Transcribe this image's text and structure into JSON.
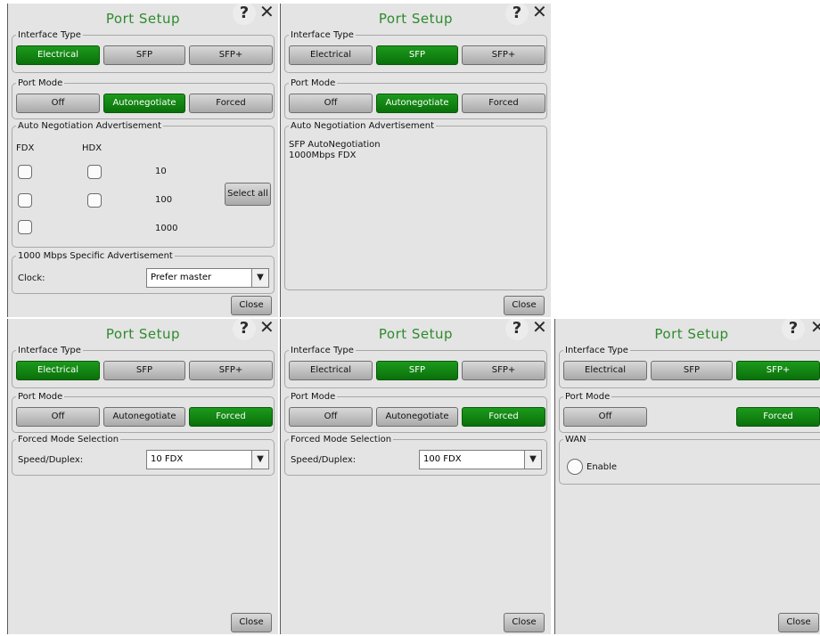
{
  "common": {
    "title": "Port Setup",
    "help_glyph": "?",
    "close_glyph": "✕",
    "interface_type_legend": "Interface Type",
    "port_mode_legend": "Port Mode",
    "iface": {
      "electrical": "Electrical",
      "sfp": "SFP",
      "sfp_plus": "SFP+"
    },
    "mode": {
      "off": "Off",
      "autonegotiate": "Autonegotiate",
      "forced": "Forced"
    },
    "close_label": "Close",
    "dropdown_arrow": "▼"
  },
  "panel1": {
    "selected_interface": "Electrical",
    "selected_mode": "Autonegotiate",
    "auto_neg_legend": "Auto Negotiation Advertisement",
    "fdx_header": "FDX",
    "hdx_header": "HDX",
    "speeds": [
      "10",
      "100",
      "1000"
    ],
    "select_all_label": "Select all",
    "specific_legend": "1000 Mbps Specific Advertisement",
    "clock_label": "Clock:",
    "clock_value": "Prefer master"
  },
  "panel2": {
    "selected_interface": "SFP",
    "selected_mode": "Autonegotiate",
    "auto_neg_legend": "Auto Negotiation Advertisement",
    "line1": "SFP AutoNegotiation",
    "line2": "1000Mbps FDX"
  },
  "panel3": {
    "selected_interface": "Electrical",
    "selected_mode": "Forced",
    "forced_legend": "Forced Mode Selection",
    "speed_label": "Speed/Duplex:",
    "speed_value": "10 FDX"
  },
  "panel4": {
    "selected_interface": "SFP",
    "selected_mode": "Forced",
    "forced_legend": "Forced Mode Selection",
    "speed_label": "Speed/Duplex:",
    "speed_value": "100 FDX"
  },
  "panel5": {
    "selected_interface": "SFP+",
    "selected_mode": "Forced",
    "wan_legend": "WAN",
    "enable_label": "Enable"
  },
  "colors": {
    "accent_green": "#0a7d0a",
    "title_green": "#2e8b2e",
    "panel_bg": "#e4e4e4"
  }
}
